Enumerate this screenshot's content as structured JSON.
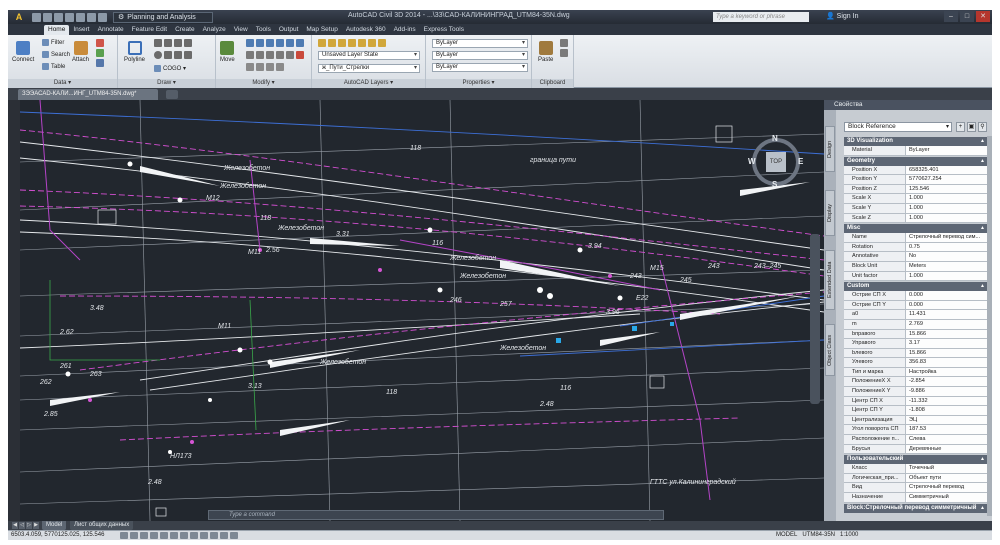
{
  "titlebar": {
    "app_letter": "A",
    "workspace": "Planning and Analysis",
    "title": "AutoCAD Civil 3D 2014 - ...\\33\\CAD-КАЛИНИНГРАД_UTM84-35N.dwg",
    "search_placeholder": "Type a keyword or phrase",
    "signin": "Sign In",
    "minimize": "–",
    "maximize": "□",
    "close": "✕"
  },
  "ribbon": {
    "tabs": [
      "Home",
      "Insert",
      "Annotate",
      "Feature Edit",
      "Create",
      "Analyze",
      "View",
      "Tools",
      "Output",
      "Map Setup",
      "Autodesk 360",
      "Add-ins",
      "Express Tools"
    ],
    "data_panel": {
      "title": "Data ▾",
      "connect": "Connect",
      "filter": "Filter",
      "search": "Search",
      "table": "Table",
      "attach": "Attach"
    },
    "draw_panel": {
      "title": "Draw ▾",
      "polyline": "Polyline",
      "cogo": "COGO ▾"
    },
    "modify_panel": {
      "title": "Modify ▾",
      "move": "Move"
    },
    "layers_panel": {
      "title": "AutoCAD Layers ▾",
      "layer_state": "Unsaved Layer State",
      "layer": "ж_Пути_Стрелки"
    },
    "properties_panel": {
      "title": "Properties ▾",
      "color": "ByLayer",
      "linetype": "ByLayer",
      "lineweight": "ByLayer"
    },
    "clipboard_panel": {
      "title": "Clipboard",
      "paste": "Paste"
    }
  },
  "document": {
    "tab": "ЗЭЭАСАD-КАЛИ...ИНГ_UTM84-35N.dwg*"
  },
  "canvas": {
    "labels": [
      "Железобетон",
      "Железобетон",
      "Железобетон",
      "Железобетон",
      "Железобетон",
      "Железобетон",
      "Железобетон",
      "116",
      "118",
      "118",
      "116",
      "118",
      "M11",
      "M11",
      "M12",
      "M15",
      "243",
      "243",
      "243–245",
      "245",
      "246",
      "2.56",
      "3.31",
      "3.48",
      "3.13",
      "3.94",
      "3.96",
      "2.85",
      "2.62",
      "261",
      "262",
      "263",
      "257",
      "E22",
      "НЛ173",
      "2.48",
      "2.48",
      "граница пути",
      "ГТТС ул.Калининградский"
    ],
    "viewcube": {
      "top": "TOP",
      "n": "N",
      "s": "S",
      "w": "W",
      "e": "E"
    }
  },
  "properties": {
    "title": "Свойства",
    "selection": "Block Reference",
    "side_tabs": [
      "Design",
      "Display",
      "Extended Data",
      "Object Class"
    ],
    "sections": [
      {
        "title": "3D Visualization",
        "rows": [
          {
            "k": "Material",
            "v": "ByLayer"
          }
        ]
      },
      {
        "title": "Geometry",
        "rows": [
          {
            "k": "Position X",
            "v": "658325.401"
          },
          {
            "k": "Position Y",
            "v": "5770627.254"
          },
          {
            "k": "Position Z",
            "v": "125.546"
          },
          {
            "k": "Scale X",
            "v": "1.000"
          },
          {
            "k": "Scale Y",
            "v": "1.000"
          },
          {
            "k": "Scale Z",
            "v": "1.000"
          }
        ]
      },
      {
        "title": "Misc",
        "rows": [
          {
            "k": "Name",
            "v": "Стрелочный перевод сим..."
          },
          {
            "k": "Rotation",
            "v": "0.75"
          },
          {
            "k": "Annotative",
            "v": "No"
          },
          {
            "k": "Block Unit",
            "v": "Meters"
          },
          {
            "k": "Unit factor",
            "v": "1.000"
          }
        ]
      },
      {
        "title": "Custom",
        "rows": [
          {
            "k": "Острие СП X",
            "v": "0.000"
          },
          {
            "k": "Острие СП Y",
            "v": "0.000"
          },
          {
            "k": "a0",
            "v": "11.431"
          },
          {
            "k": "m",
            "v": "2.769"
          },
          {
            "k": "bправого",
            "v": "15.866"
          },
          {
            "k": "Управого",
            "v": "3.17"
          },
          {
            "k": "bлевого",
            "v": "15.866"
          },
          {
            "k": "Улевого",
            "v": "356.83"
          },
          {
            "k": "Тип и марка",
            "v": "Настройка"
          },
          {
            "k": "ПоложениеX X",
            "v": "-2.854"
          },
          {
            "k": "ПоложениеX Y",
            "v": "-9.886"
          },
          {
            "k": "Центр СП X",
            "v": "-11.332"
          },
          {
            "k": "Центр СП Y",
            "v": "-1.808"
          },
          {
            "k": "Централизация",
            "v": "ЭЦ"
          },
          {
            "k": "Угол поворота СП",
            "v": "187.53"
          },
          {
            "k": "Расположение п...",
            "v": "Слева"
          },
          {
            "k": "Брусья",
            "v": "Деревянные"
          }
        ]
      },
      {
        "title": "Пользовательский",
        "rows": [
          {
            "k": "Класс",
            "v": "Точечный"
          },
          {
            "k": "Логическая_при...",
            "v": "Объект пути"
          },
          {
            "k": "Вид",
            "v": "Стрелочный перевод"
          },
          {
            "k": "Назначение",
            "v": "Симметричный"
          }
        ]
      },
      {
        "title": "Block:Стрелочный перевод симметричный",
        "rows": []
      }
    ]
  },
  "layout_tabs": [
    "Model",
    "Лист общих данных"
  ],
  "command": {
    "prompt": "Type a command"
  },
  "status": {
    "coords": "6503.4.059, 5770125.025, 125.546",
    "model": "MODEL",
    "crs": "UTM84-35N",
    "scale": "1:1000"
  }
}
